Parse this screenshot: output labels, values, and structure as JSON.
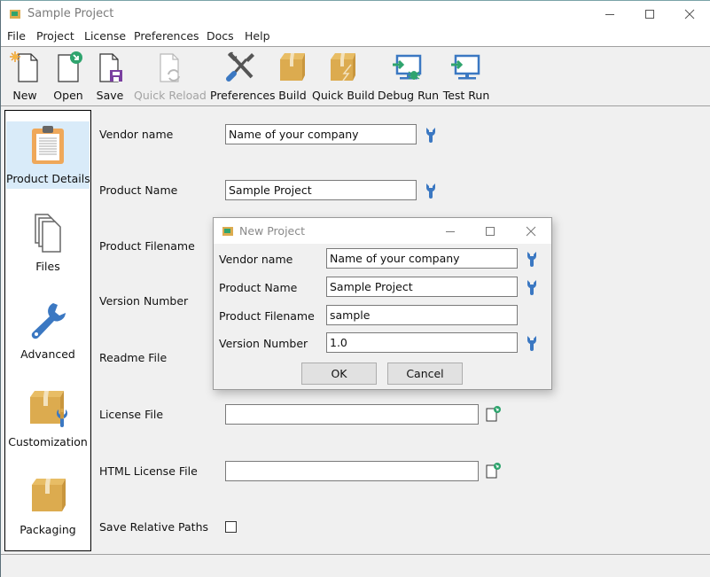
{
  "window": {
    "title": "Sample Project",
    "controls": [
      "minimize",
      "maximize",
      "close"
    ]
  },
  "menu": {
    "items": [
      "File",
      "Project",
      "License",
      "Preferences",
      "Docs",
      "Help"
    ]
  },
  "toolbar": {
    "buttons": [
      {
        "label": "New",
        "icon": "new-file-icon",
        "enabled": true
      },
      {
        "label": "Open",
        "icon": "open-file-icon",
        "enabled": true
      },
      {
        "label": "Save",
        "icon": "save-file-icon",
        "enabled": true
      },
      {
        "label": "Quick Reload",
        "icon": "reload-icon",
        "enabled": false
      },
      {
        "label": "Preferences",
        "icon": "tools-icon",
        "enabled": true
      },
      {
        "label": "Build",
        "icon": "box-icon",
        "enabled": true
      },
      {
        "label": "Quick Build",
        "icon": "box-lightning-icon",
        "enabled": true
      },
      {
        "label": "Debug Run",
        "icon": "monitor-bug-icon",
        "enabled": true
      },
      {
        "label": "Test Run",
        "icon": "monitor-arrow-icon",
        "enabled": true
      }
    ]
  },
  "sidebar": {
    "items": [
      {
        "label": "Product Details",
        "icon": "clipboard-icon",
        "active": true
      },
      {
        "label": "Files",
        "icon": "files-icon",
        "active": false
      },
      {
        "label": "Advanced",
        "icon": "wrench-icon",
        "active": false
      },
      {
        "label": "Customization",
        "icon": "box-wrench-icon",
        "active": false
      },
      {
        "label": "Packaging",
        "icon": "box-icon",
        "active": false
      }
    ]
  },
  "form": {
    "vendor_name": {
      "label": "Vendor name",
      "value": "Name of your company"
    },
    "product_name": {
      "label": "Product Name",
      "value": "Sample Project"
    },
    "product_filename": {
      "label": "Product Filename"
    },
    "version_number": {
      "label": "Version Number"
    },
    "readme_file": {
      "label": "Readme File"
    },
    "license_file": {
      "label": "License File",
      "value": ""
    },
    "html_license_file": {
      "label": "HTML License File",
      "value": ""
    },
    "save_relative_paths": {
      "label": "Save Relative Paths",
      "checked": false
    }
  },
  "dialog": {
    "title": "New Project",
    "fields": {
      "vendor_name": {
        "label": "Vendor name",
        "value": "Name of your company"
      },
      "product_name": {
        "label": "Product Name",
        "value": "Sample Project"
      },
      "product_filename": {
        "label": "Product Filename",
        "value": "sample"
      },
      "version_number": {
        "label": "Version Number",
        "value": "1.0"
      }
    },
    "ok_label": "OK",
    "cancel_label": "Cancel"
  },
  "colors": {
    "accent_blue": "#3b78c2",
    "box_gold": "#dcab4f",
    "green": "#2fa46e",
    "sidebar_active": "#d9ebf9"
  }
}
